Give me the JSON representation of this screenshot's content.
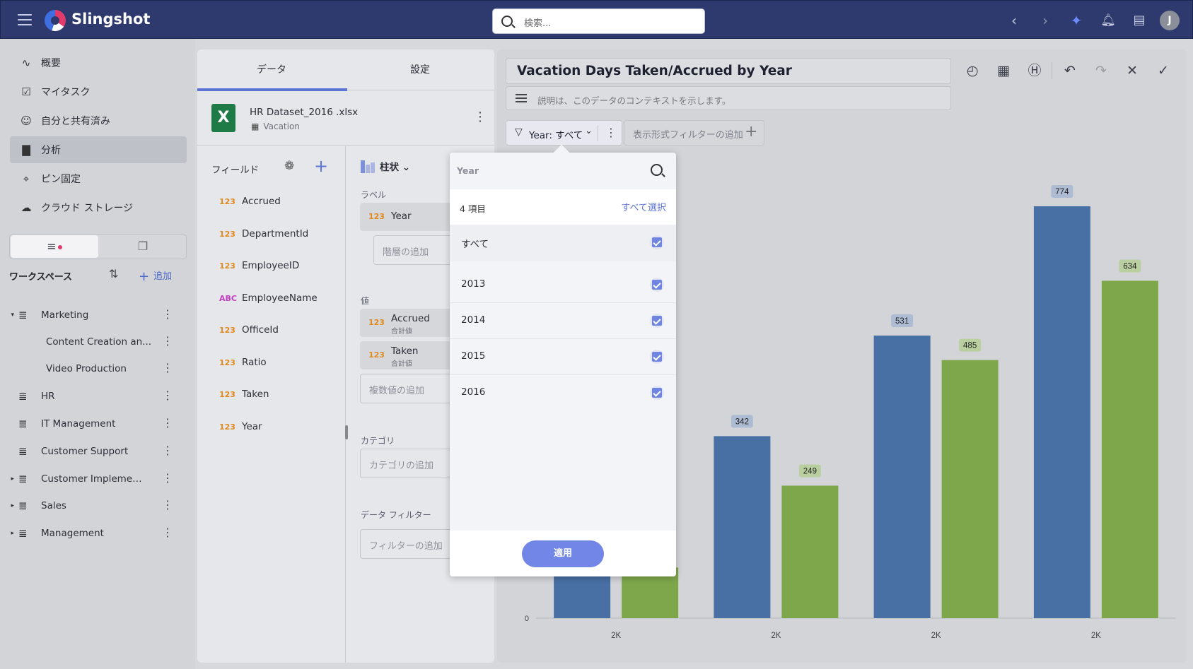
{
  "app": {
    "brand": "Slingshot",
    "search_placeholder": "検索...",
    "avatar_initial": "J"
  },
  "topbar_icons": [
    "chevron-left-icon",
    "chevron-right-icon",
    "sparkle-icon",
    "bell-icon",
    "chat-icon"
  ],
  "nav": [
    {
      "label": "概要",
      "icon": "activity-icon"
    },
    {
      "label": "マイタスク",
      "icon": "task-icon"
    },
    {
      "label": "自分と共有済み",
      "icon": "shared-user-icon"
    },
    {
      "label": "分析",
      "icon": "chart-bar-icon",
      "active": true
    },
    {
      "label": "ピン固定",
      "icon": "pin-icon"
    },
    {
      "label": "クラウド ストレージ",
      "icon": "cloud-icon"
    }
  ],
  "workspace": {
    "title": "ワークスペース",
    "add_label": "追加",
    "items": [
      {
        "name": "Marketing",
        "expanded": true,
        "level": 0
      },
      {
        "name": "Content Creation an...",
        "level": 1
      },
      {
        "name": "Video Production",
        "level": 1
      },
      {
        "name": "HR",
        "level": 0
      },
      {
        "name": "IT Management",
        "level": 0
      },
      {
        "name": "Customer Support",
        "level": 0
      },
      {
        "name": "Customer Implementa...",
        "level": 0,
        "collapsed": true
      },
      {
        "name": "Sales",
        "level": 0,
        "collapsed": true
      },
      {
        "name": "Management",
        "level": 0,
        "collapsed": true
      }
    ]
  },
  "panel": {
    "tab_data": "データ",
    "tab_settings": "設定",
    "dataset_name": "HR Dataset_2016 .xlsx",
    "sheet_name": "Vacation",
    "fields_header": "フィールド",
    "fields": [
      {
        "type": "123",
        "name": "Accrued"
      },
      {
        "type": "123",
        "name": "DepartmentId"
      },
      {
        "type": "123",
        "name": "EmployeeID"
      },
      {
        "type": "ABC",
        "name": "EmployeeName"
      },
      {
        "type": "123",
        "name": "OfficeId"
      },
      {
        "type": "123",
        "name": "Ratio"
      },
      {
        "type": "123",
        "name": "Taken"
      },
      {
        "type": "123",
        "name": "Year"
      }
    ],
    "chart_type": "柱状",
    "label_section": "ラベル",
    "label_field": "Year",
    "add_hierarchy": "階層の追加",
    "values_section": "値",
    "value_fields": [
      {
        "name": "Accrued",
        "agg": "合計値"
      },
      {
        "name": "Taken",
        "agg": "合計値"
      }
    ],
    "add_values": "複数値の追加",
    "category_section": "カテゴリ",
    "add_category": "カテゴリの追加",
    "data_filter_section": "データ フィルター",
    "add_filter": "フィルターの追加"
  },
  "viz": {
    "title": "Vacation Days Taken/Accrued by Year",
    "description_placeholder": "説明は、このデータのコンテキストを示します。",
    "filter_label": "Year: すべて",
    "add_visual_filter": "表示形式フィルターの追加"
  },
  "popup": {
    "search_placeholder": "Year",
    "count": "4 項目",
    "select_all": "すべて選択",
    "all_label": "すべて",
    "options": [
      "2013",
      "2014",
      "2015",
      "2016"
    ],
    "apply": "適用"
  },
  "chart_data": {
    "type": "bar",
    "categories": [
      "2K",
      "2K",
      "2K",
      "2K"
    ],
    "series": [
      {
        "values": [
          95,
          342,
          531,
          774
        ],
        "color": "#4870a4"
      },
      {
        "values": [
          95,
          249,
          485,
          634
        ],
        "color": "#7ea74b"
      }
    ],
    "data_labels": [
      [
        "",
        "342",
        "531",
        "774"
      ],
      [
        "",
        "249",
        "485",
        "634"
      ]
    ],
    "ylim": [
      0,
      774
    ],
    "y_tick_labels": [
      "0"
    ],
    "grid": false
  }
}
